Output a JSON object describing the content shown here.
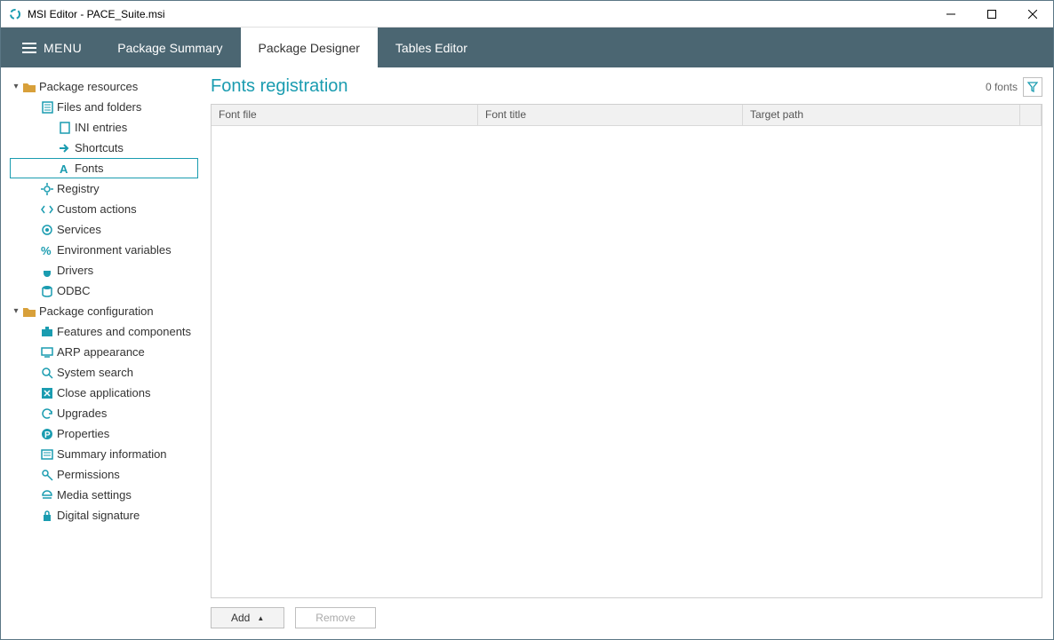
{
  "window": {
    "title": "MSI Editor - PACE_Suite.msi"
  },
  "menu": {
    "label": "MENU"
  },
  "tabs": {
    "summary": "Package Summary",
    "designer": "Package Designer",
    "tables": "Tables Editor"
  },
  "sidebar": {
    "group_resources": "Package resources",
    "files_folders": "Files and folders",
    "ini": "INI entries",
    "shortcuts": "Shortcuts",
    "fonts": "Fonts",
    "registry": "Registry",
    "custom_actions": "Custom actions",
    "services": "Services",
    "env": "Environment variables",
    "drivers": "Drivers",
    "odbc": "ODBC",
    "group_config": "Package configuration",
    "features": "Features and components",
    "arp": "ARP appearance",
    "search": "System search",
    "close_apps": "Close applications",
    "upgrades": "Upgrades",
    "properties": "Properties",
    "summary_info": "Summary information",
    "permissions": "Permissions",
    "media": "Media settings",
    "digital_sig": "Digital signature"
  },
  "main": {
    "title": "Fonts registration",
    "count": "0 fonts",
    "columns": {
      "file": "Font file",
      "title": "Font title",
      "path": "Target path"
    },
    "add": "Add",
    "remove": "Remove"
  },
  "colors": {
    "accent": "#1a9cb0",
    "menubar": "#4b6672",
    "folder": "#d8a03a"
  }
}
